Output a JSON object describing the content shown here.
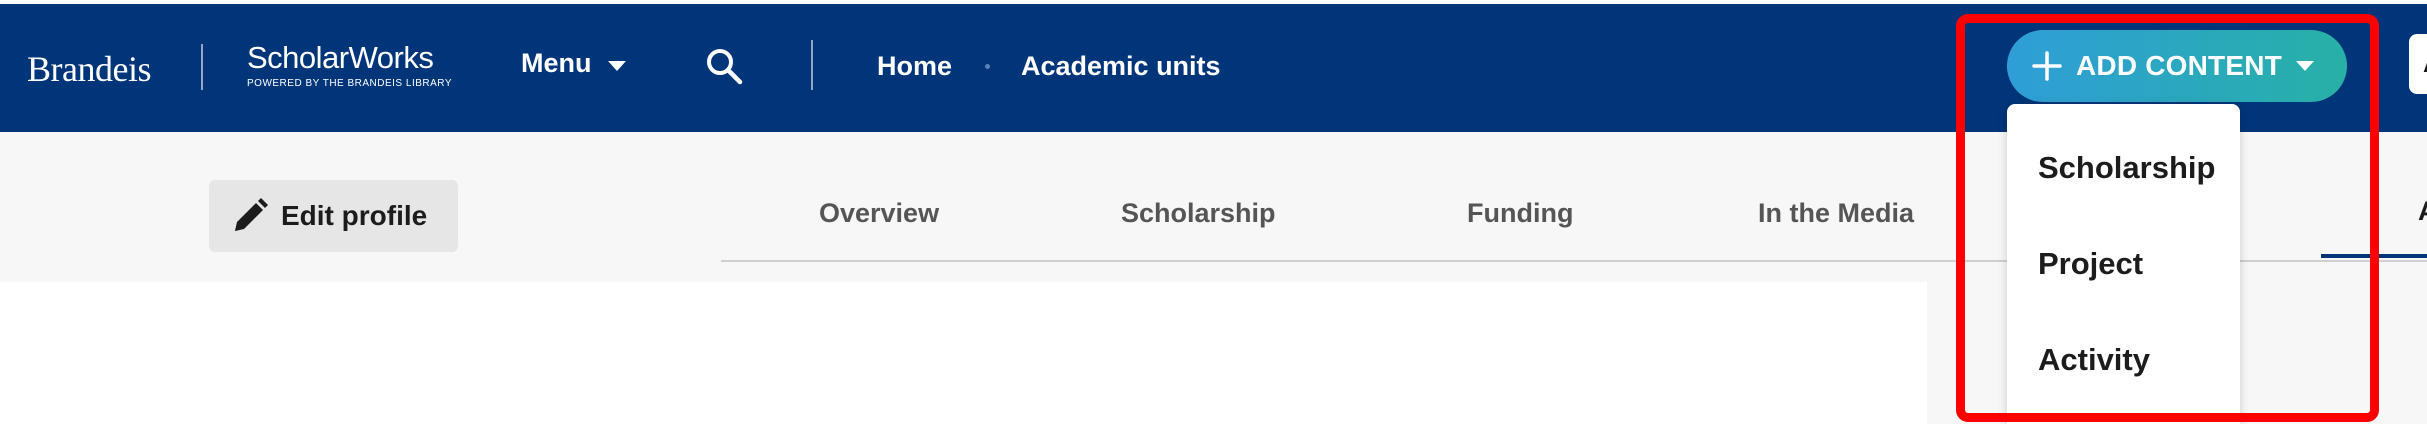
{
  "header": {
    "brand_left": "Brandeis",
    "brand_right_name": "ScholarWorks",
    "brand_right_tag": "POWERED BY THE BRANDEIS LIBRARY",
    "menu_label": "Menu",
    "breadcrumbs": [
      "Home",
      "Academic units"
    ],
    "add_content_label": "ADD CONTENT",
    "avatar_initial": "A"
  },
  "add_content_menu": {
    "items": [
      "Scholarship",
      "Project",
      "Activity"
    ]
  },
  "profile": {
    "edit_label": "Edit profile",
    "tabs": [
      "Overview",
      "Scholarship",
      "Funding",
      "In the Media"
    ],
    "active_tab_initial": "A"
  },
  "colors": {
    "nav_bg": "#003579",
    "accent_gradient_start": "#2f9ed8",
    "accent_gradient_end": "#27b0a6",
    "highlight": "#ff0000"
  },
  "icons": [
    "chevron-down-icon",
    "search-icon",
    "plus-icon",
    "pencil-icon"
  ]
}
